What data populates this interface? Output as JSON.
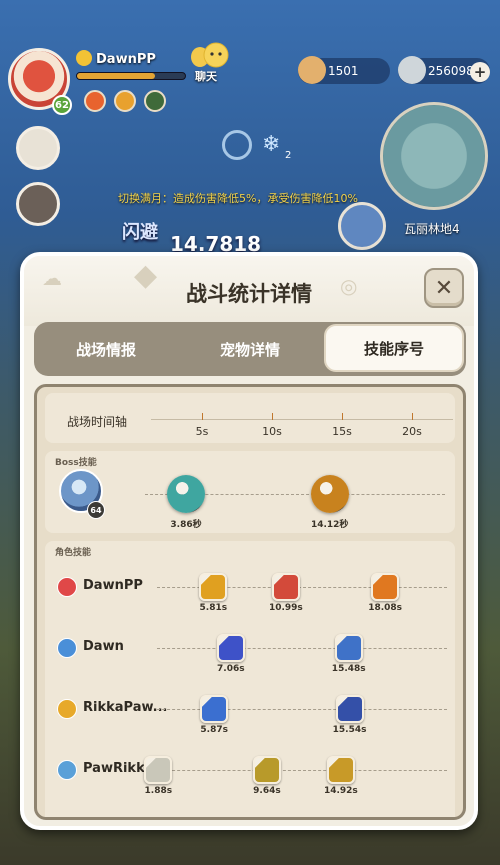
{
  "hud": {
    "player_name": "DawnPP",
    "player_level": "62",
    "hp_fraction": 0.72,
    "chat_label": "聊天",
    "currency_1": "1501",
    "currency_2": "256098",
    "plus_label": "+",
    "map_name": "瓦丽林地4",
    "buff_text": "切换满月：造成伤害降低5%，承受伤害降低10%",
    "dodge_text": "闪避",
    "damage_text": "14.7818",
    "snow_count": "2"
  },
  "dialog": {
    "title": "战斗统计详情",
    "close_label": "✕",
    "tabs": [
      {
        "label": "战场情报",
        "active": false
      },
      {
        "label": "宠物详情",
        "active": false
      },
      {
        "label": "技能序号",
        "active": true
      }
    ],
    "timeline": {
      "label": "战场时间轴",
      "ticks": [
        "5s",
        "10s",
        "15s",
        "20s"
      ]
    },
    "boss": {
      "section_label": "Boss技能",
      "level": "64",
      "skills": [
        {
          "time": 3.86,
          "label": "3.86秒",
          "icon": "whirlwind-icon",
          "color": "#3fa6a0"
        },
        {
          "time": 14.12,
          "label": "14.12秒",
          "icon": "crescent-blade-icon",
          "color": "#c8821e"
        }
      ]
    },
    "characters_label": "角色技能",
    "characters": [
      {
        "name": "DawnPP",
        "icon": "red-element-icon",
        "icon_color": "#e04848",
        "skills": [
          {
            "time": 5.81,
            "label": "5.81s",
            "icon": "arrows-icon",
            "color": "#e0a020"
          },
          {
            "time": 10.99,
            "label": "10.99s",
            "icon": "fire-face-icon",
            "color": "#d34a3a"
          },
          {
            "time": 18.08,
            "label": "18.08s",
            "icon": "fist-icon",
            "color": "#e07820"
          }
        ]
      },
      {
        "name": "Dawn",
        "icon": "blue-element-icon",
        "icon_color": "#4a8fd8",
        "skills": [
          {
            "time": 7.06,
            "label": "7.06s",
            "icon": "lightning-icon",
            "color": "#3e52c8"
          },
          {
            "time": 15.48,
            "label": "15.48s",
            "icon": "shard-icon",
            "color": "#3f72c8"
          }
        ]
      },
      {
        "name": "RikkaPaw...",
        "icon": "yellow-element-icon",
        "icon_color": "#e7a92a",
        "skills": [
          {
            "time": 5.87,
            "label": "5.87s",
            "icon": "swirl-icon",
            "color": "#3b6fd0"
          },
          {
            "time": 15.54,
            "label": "15.54s",
            "icon": "beast-icon",
            "color": "#3450a8"
          }
        ]
      },
      {
        "name": "PawRikk...",
        "icon": "wind-element-icon",
        "icon_color": "#5aa0d8",
        "skills": [
          {
            "time": 1.88,
            "label": "1.88s",
            "icon": "pet-icon",
            "color": "#c9c7b9"
          },
          {
            "time": 9.64,
            "label": "9.64s",
            "icon": "heart-shield-icon",
            "color": "#b89a2a"
          },
          {
            "time": 14.92,
            "label": "14.92s",
            "icon": "sparkle-icon",
            "color": "#c89a28"
          }
        ]
      }
    ]
  }
}
